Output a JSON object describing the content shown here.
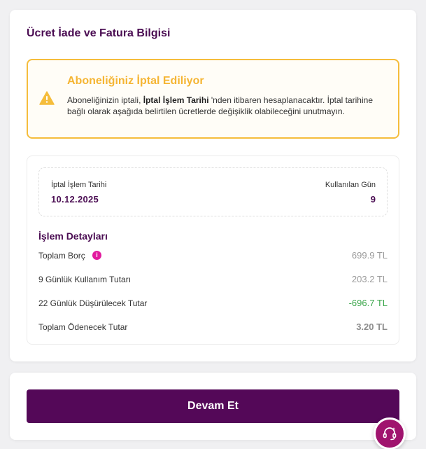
{
  "header": {
    "title": "Ücret İade ve Fatura Bilgisi"
  },
  "warning": {
    "title": "Aboneliğiniz İptal Ediliyor",
    "text_before": "Aboneliğinizin iptali, ",
    "text_bold": "İptal İşlem Tarihi",
    "text_after": " 'nden itibaren hesaplanacaktır. İptal tarihine bağlı olarak aşağıda belirtilen ücretlerde değişiklik olabileceğini unutmayın.",
    "icon": "warning-triangle-icon",
    "color": "#f5bd3c"
  },
  "summary": {
    "date_label": "İptal İşlem Tarihi",
    "date_value": "10.12.2025",
    "days_label": "Kullanılan Gün",
    "days_value": "9"
  },
  "details": {
    "title": "İşlem Detayları",
    "rows": [
      {
        "label": "Toplam Borç",
        "value": "699.9 TL",
        "has_info": true
      },
      {
        "label": "9 Günlük Kullanım Tutarı",
        "value": "203.2 TL"
      },
      {
        "label": "22 Günlük Düşürülecek Tutar",
        "value": "-696.7 TL",
        "color": "#3aa64a"
      },
      {
        "label": "Toplam Ödenecek Tutar",
        "value": "3.20 TL"
      }
    ],
    "info_glyph": "i"
  },
  "footer": {
    "continue_label": "Devam Et",
    "brand_color": "#540858"
  },
  "support": {
    "icon": "support-headset-icon"
  }
}
